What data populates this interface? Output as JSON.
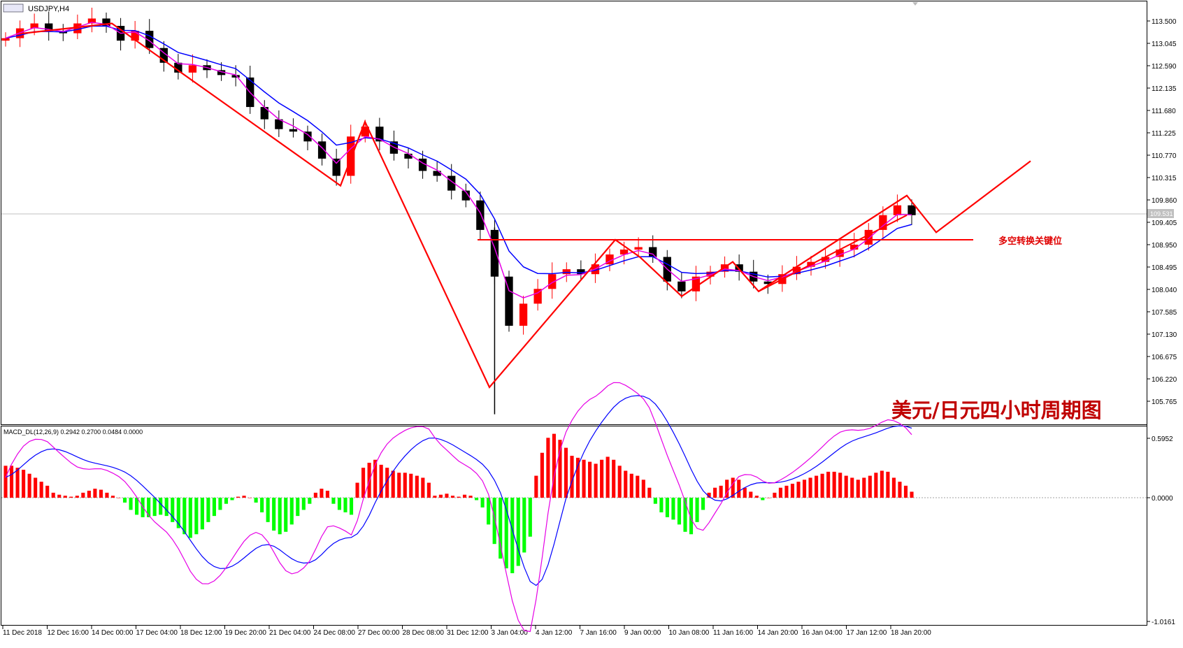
{
  "symbol": "USDJPY,H4",
  "headline": "美元/日元四小时周期图",
  "annotation": "多空转换关键位",
  "current_price_label": "109.531",
  "macd_label": "MACD_DL(12,26,9) 0.2942 0.2700 0.0484 0.0000",
  "colors": {
    "bull": "#ff0000",
    "bear": "#000000",
    "ma_fast": "#e600e6",
    "ma_slow": "#0000ff",
    "zigzag": "#ff0000",
    "hist_pos": "#ff0000",
    "hist_neg": "#00ff00",
    "macd_line": "#0000ff",
    "signal_line": "#e600e6"
  },
  "chart_data": [
    {
      "type": "candlestick",
      "title": "USDJPY,H4",
      "ylim": [
        105.5,
        113.8
      ],
      "y_ticks": [
        "113.500",
        "113.045",
        "112.590",
        "112.135",
        "111.680",
        "111.225",
        "110.770",
        "110.315",
        "109.860",
        "109.405",
        "108.950",
        "108.495",
        "108.040",
        "107.585",
        "107.130",
        "106.675",
        "106.220",
        "105.765"
      ],
      "x_ticks": [
        "11 Dec 2018",
        "12 Dec 16:00",
        "14 Dec 00:00",
        "17 Dec 04:00",
        "18 Dec 12:00",
        "19 Dec 20:00",
        "21 Dec 04:00",
        "24 Dec 08:00",
        "27 Dec 00:00",
        "28 Dec 08:00",
        "31 Dec 12:00",
        "3 Jan 04:00",
        "4 Jan 12:00",
        "7 Jan 16:00",
        "9 Jan 00:00",
        "10 Jan 08:00",
        "11 Jan 16:00",
        "14 Jan 20:00",
        "16 Jan 04:00",
        "17 Jan 12:00",
        "18 Jan 20:00"
      ],
      "close_path": [
        113.15,
        113.35,
        113.45,
        113.3,
        113.25,
        113.45,
        113.55,
        113.4,
        113.1,
        113.3,
        112.95,
        112.65,
        112.45,
        112.6,
        112.5,
        112.4,
        112.35,
        111.75,
        111.5,
        111.3,
        111.25,
        111.05,
        110.7,
        110.35,
        111.15,
        111.35,
        111.05,
        110.8,
        110.7,
        110.45,
        110.35,
        110.05,
        109.85,
        109.25,
        108.3,
        107.3,
        107.75,
        108.05,
        108.35,
        108.45,
        108.35,
        108.55,
        108.75,
        108.85,
        108.9,
        108.7,
        108.2,
        108.0,
        108.3,
        108.4,
        108.55,
        108.4,
        108.2,
        108.15,
        108.35,
        108.5,
        108.6,
        108.7,
        108.85,
        108.95,
        109.25,
        109.55,
        109.75,
        109.55
      ],
      "zigzag": [
        {
          "x": "12 Dec",
          "y": 113.25
        },
        {
          "x": "14 Dec",
          "y": 113.45
        },
        {
          "x": "24 Dec",
          "y": 110.15
        },
        {
          "x": "27 Dec",
          "y": 111.45
        },
        {
          "x": "3 Jan",
          "y": 106.05
        },
        {
          "x": "7 Jan",
          "y": 109.05
        },
        {
          "x": "9 Jan",
          "y": 108.7
        },
        {
          "x": "10 Jan",
          "y": 107.9
        },
        {
          "x": "11 Jan",
          "y": 108.6
        },
        {
          "x": "14 Jan",
          "y": 108.0
        },
        {
          "x": "18 Jan",
          "y": 109.95
        },
        {
          "x": "18 Jan",
          "y": 109.2
        },
        {
          "x": "projection",
          "y": 110.65
        }
      ],
      "horizontal_level": {
        "y": 109.05,
        "label": "多空转换关键位"
      },
      "current_price": 109.531
    },
    {
      "type": "bar",
      "title": "MACD_DL(12,26,9) 0.2942 0.2700 0.0484 0.0000",
      "ylim": [
        -1.0161,
        0.5952
      ],
      "y_ticks": [
        "0.5952",
        "0.0000",
        "-1.0161"
      ],
      "series": [
        {
          "values": [
            0.32,
            0.32,
            0.3,
            0.28,
            0.24,
            0.2,
            0.16,
            0.12,
            0.05,
            0.03,
            0.02,
            0.01,
            0.02,
            0.05,
            0.07,
            0.09,
            0.08,
            0.05,
            0.02,
            0.0,
            -0.04,
            -0.1,
            -0.14,
            -0.16,
            -0.16,
            -0.15,
            -0.14,
            -0.15,
            -0.2,
            -0.25,
            -0.3,
            -0.33,
            -0.3,
            -0.26,
            -0.2,
            -0.15,
            -0.1,
            -0.05,
            -0.02,
            0.01,
            0.02,
            0.0,
            -0.04,
            -0.12,
            -0.2,
            -0.27,
            -0.3,
            -0.28,
            -0.22,
            -0.15,
            -0.1,
            -0.05,
            0.05,
            0.09,
            0.07,
            -0.05,
            -0.1,
            -0.12,
            -0.14,
            0.15,
            0.3,
            0.35,
            0.38,
            0.33,
            0.3,
            0.27,
            0.25,
            0.25,
            0.24,
            0.22,
            0.2,
            0.15,
            0.02,
            0.03,
            0.04,
            0.02,
            0.01,
            0.03,
            0.02,
            -0.02,
            -0.08,
            -0.22,
            -0.38,
            -0.5,
            -0.58,
            -0.62,
            -0.56,
            -0.45,
            -0.32,
            0.22,
            0.45,
            0.6,
            0.64,
            0.58,
            0.5,
            0.42,
            0.4,
            0.38,
            0.36,
            0.34,
            0.38,
            0.41,
            0.38,
            0.32,
            0.27,
            0.24,
            0.22,
            0.18,
            0.1,
            -0.05,
            -0.12,
            -0.16,
            -0.18,
            -0.22,
            -0.28,
            -0.3,
            -0.2,
            -0.1,
            0.05,
            0.1,
            0.12,
            0.18,
            0.2,
            0.18,
            0.1,
            0.06,
            0.02,
            -0.02,
            0.0,
            0.05,
            0.1,
            0.12,
            0.14,
            0.16,
            0.18,
            0.2,
            0.22,
            0.24,
            0.26,
            0.26,
            0.25,
            0.22,
            0.2,
            0.18,
            0.2,
            0.22,
            0.25,
            0.27,
            0.26,
            0.2,
            0.16,
            0.12,
            0.06
          ]
        }
      ]
    }
  ]
}
